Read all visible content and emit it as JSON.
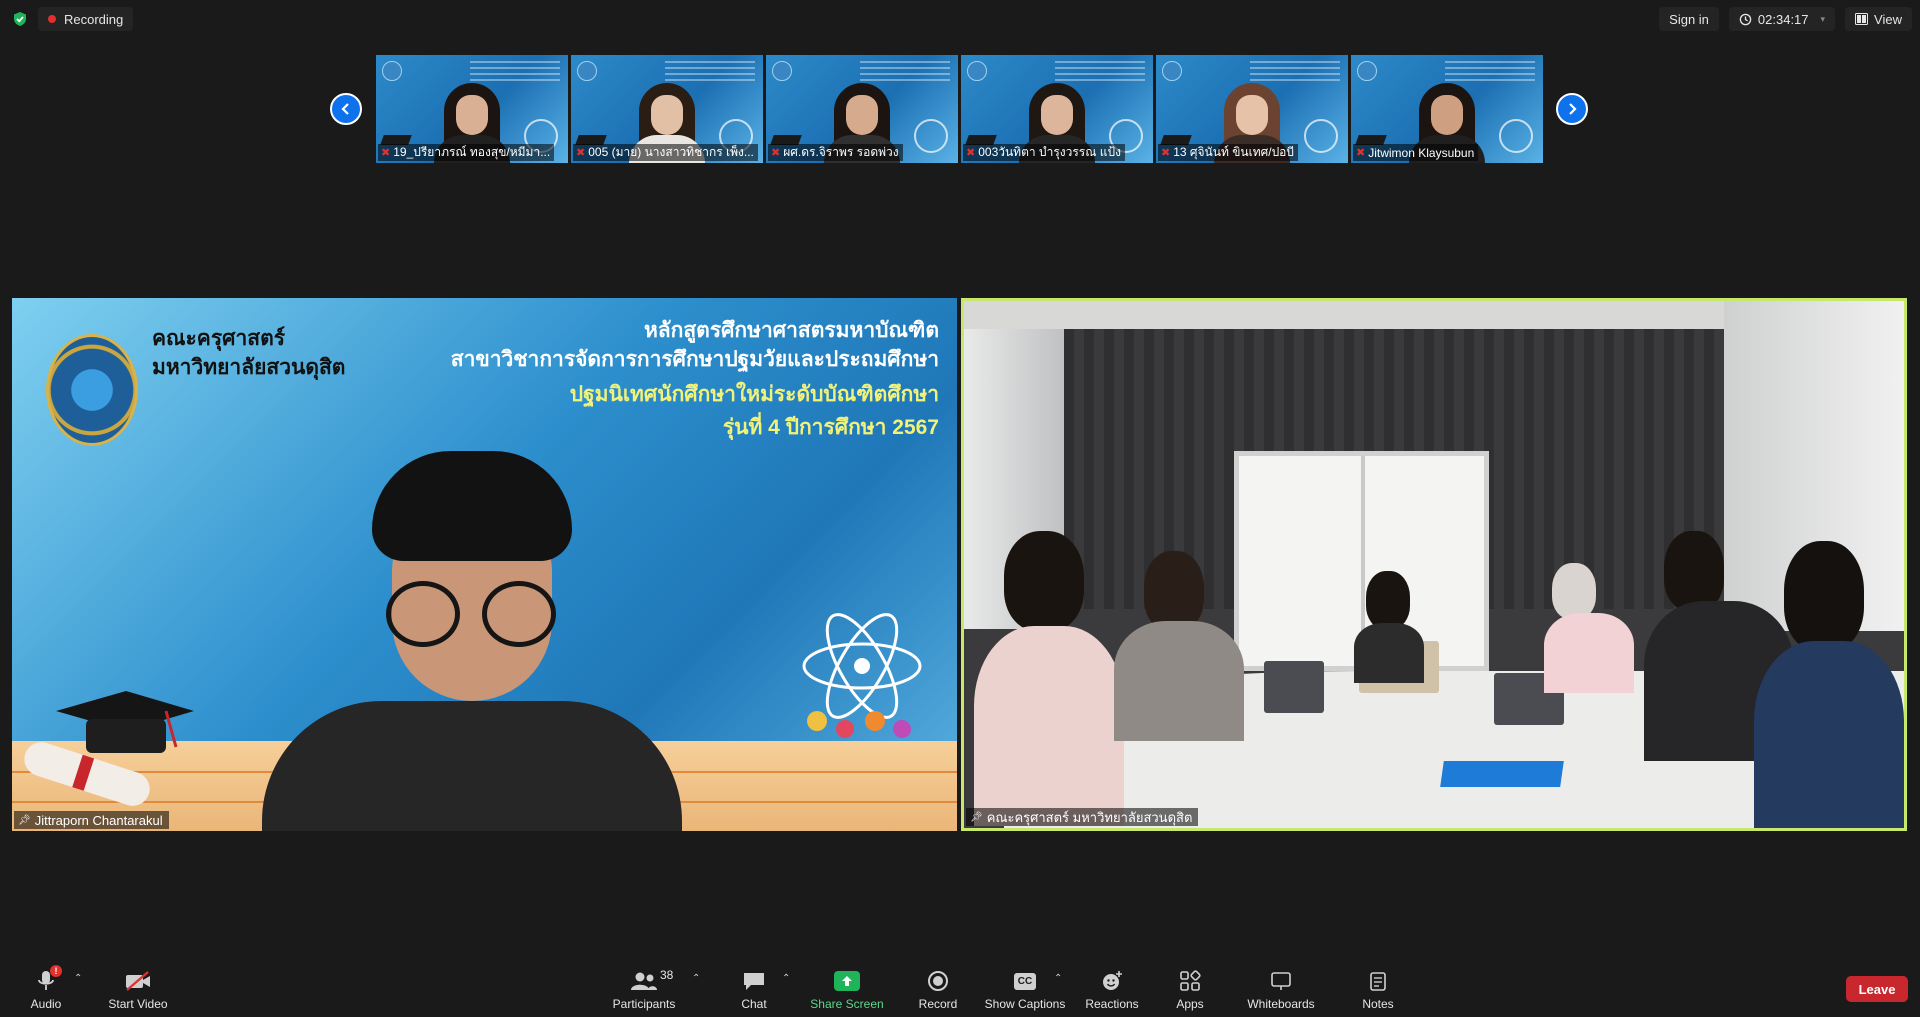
{
  "topbar": {
    "recording_label": "Recording",
    "sign_in_label": "Sign in",
    "timer": "02:34:17",
    "view_label": "View"
  },
  "thumbnails": [
    {
      "name": "19_ปรียาภรณ์ ทองสุข/หมีมา..."
    },
    {
      "name": "005 (มาย) นางสาวทิชากร เพ็ง..."
    },
    {
      "name": "ผศ.ดร.จิราพร รอดพ่วง"
    },
    {
      "name": "003วันทิตา บำรุงวรรณ แป้ง"
    },
    {
      "name": "13 ศุจินันท์ ขินเทศ/ปอบี"
    },
    {
      "name": "Jitwimon Klaysubun"
    }
  ],
  "left_tile": {
    "name": "Jittraporn Chantarakul",
    "slide": {
      "faculty_line1": "คณะครุศาสตร์",
      "faculty_line2": "มหาวิทยาลัยสวนดุสิต",
      "title_line1": "หลักสูตรศึกษาศาสตรมหาบัณฑิต",
      "title_line2": "สาขาวิชาการจัดการการศึกษาปฐมวัยและประถมศึกษา",
      "title_line3": "ปฐมนิเทศนักศึกษาใหม่ระดับบัณฑิตศึกษา",
      "title_line4": "รุ่นที่  4  ปีการศึกษา 2567"
    }
  },
  "right_tile": {
    "name": "คณะครุศาสตร์ มหาวิทยาลัยสวนดุสิต"
  },
  "toolbar": {
    "audio_label": "Audio",
    "audio_badge": "!",
    "video_label": "Start Video",
    "participants_label": "Participants",
    "participants_count": "38",
    "chat_label": "Chat",
    "share_label": "Share Screen",
    "record_label": "Record",
    "captions_label": "Show Captions",
    "captions_icon_text": "CC",
    "reactions_label": "Reactions",
    "apps_label": "Apps",
    "whiteboards_label": "Whiteboards",
    "notes_label": "Notes",
    "leave_label": "Leave"
  },
  "colors": {
    "background": "#1a1a1a",
    "share_green": "#1fb35a",
    "leave_red": "#c9272e",
    "active_speaker_border": "#c7e86a",
    "nav_blue": "#0e72ed"
  }
}
